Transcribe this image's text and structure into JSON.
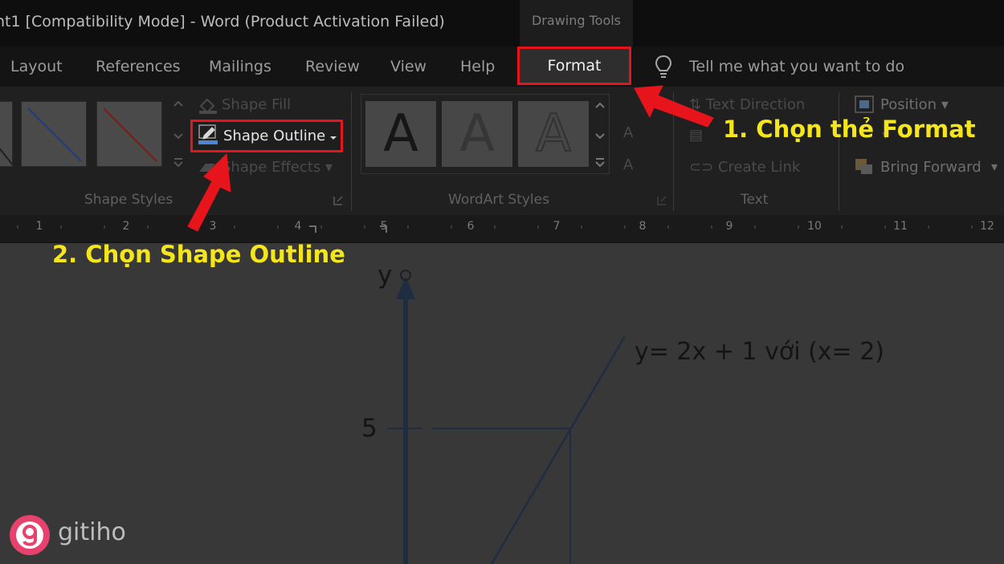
{
  "window": {
    "title": "nt1 [Compatibility Mode]  -  Word (Product Activation Failed)",
    "contextual_tab_group": "Drawing Tools"
  },
  "tabs": [
    {
      "label": "Layout"
    },
    {
      "label": "References"
    },
    {
      "label": "Mailings"
    },
    {
      "label": "Review"
    },
    {
      "label": "View"
    },
    {
      "label": "Help"
    }
  ],
  "active_tab": "Format",
  "tell_me": "Tell me what you want to do",
  "ribbon": {
    "shape_styles": {
      "label": "Shape Styles",
      "shape_fill": "Shape Fill",
      "shape_outline": "Shape Outline",
      "shape_effects": "Shape Effects"
    },
    "wordart_styles": {
      "label": "WordArt Styles",
      "thumb_letter": "A"
    },
    "text": {
      "label": "Text",
      "text_direction": "Text Direction",
      "create_link": "Create Link"
    },
    "arrange": {
      "position": "Position",
      "bring_forward": "Bring Forward"
    }
  },
  "ruler": {
    "numbers": [
      "1",
      "2",
      "3",
      "4",
      "5",
      "6",
      "7",
      "8",
      "9",
      "10",
      "11",
      "12"
    ]
  },
  "annotations": {
    "step1": "1. Chọn thẻ Format",
    "step2": "2. Chọn Shape Outline"
  },
  "document": {
    "y_axis_label": "y",
    "tick_label": "5",
    "equation": "y= 2x + 1 với (x= 2)"
  },
  "watermark": {
    "brand": "gitiho"
  },
  "colors": {
    "highlight_border": "#e8141b",
    "callout_text": "#f5e61c",
    "arrow": "#e8141b",
    "graph_line": "#1e2d40"
  }
}
